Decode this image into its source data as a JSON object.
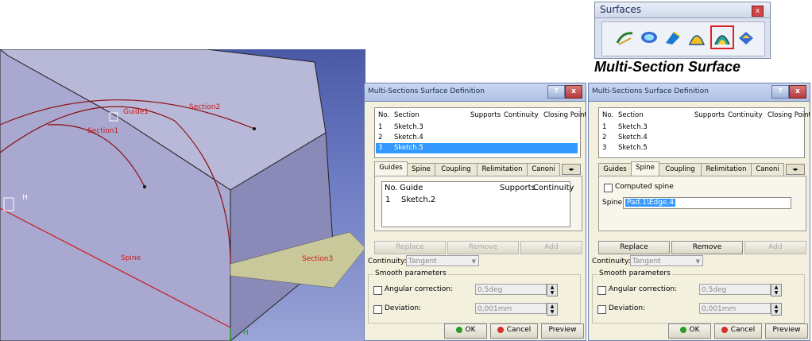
{
  "viewport": {
    "labels": {
      "guide1": "Guide1",
      "section2": "Section2",
      "section1": "Section1",
      "section3": "Section3",
      "spine": "Spine",
      "h_left": "H",
      "h_bottom": "H"
    }
  },
  "toolbar": {
    "title": "Surfaces",
    "close": "x",
    "icons": [
      "sweep-icon",
      "fill-icon",
      "extrude-icon",
      "loft-icon",
      "multi-section-surface-icon",
      "blend-icon"
    ],
    "highlight_color": "#e02020"
  },
  "caption": "Multi-Section Surface",
  "dialog1": {
    "title": "Multi-Sections Surface Definition",
    "help": "?",
    "close": "x",
    "columns": [
      "No.",
      "Section",
      "Supports",
      "Continuity",
      "Closing Point"
    ],
    "rows": [
      {
        "no": "1",
        "section": "Sketch.3"
      },
      {
        "no": "2",
        "section": "Sketch.4"
      },
      {
        "no": "3",
        "section": "Sketch.5"
      }
    ],
    "selected_row": 3,
    "tabs": [
      "Guides",
      "Spine",
      "Coupling",
      "Relimitation",
      "Canoni"
    ],
    "tab_scroll": "◂▸",
    "active_tab": "Guides",
    "guide_columns": [
      "No.",
      "Guide",
      "Supports",
      "Continuity"
    ],
    "guide_rows": [
      {
        "no": "1",
        "guide": "Sketch.2"
      }
    ],
    "replace": "Replace",
    "remove": "Remove",
    "add": "Add",
    "continuity_label": "Continuity:",
    "continuity_value": "Tangent",
    "smooth_title": "Smooth parameters",
    "angular_label": "Angular correction:",
    "angular_value": "0,5deg",
    "deviation_label": "Deviation:",
    "deviation_value": "0,001mm",
    "ok": "OK",
    "cancel": "Cancel",
    "preview": "Preview"
  },
  "dialog2": {
    "title": "Multi-Sections Surface Definition",
    "help": "?",
    "close": "x",
    "columns": [
      "No.",
      "Section",
      "Supports",
      "Continuity",
      "Closing Point"
    ],
    "rows": [
      {
        "no": "1",
        "section": "Sketch.3"
      },
      {
        "no": "2",
        "section": "Sketch.4"
      },
      {
        "no": "3",
        "section": "Sketch.5"
      }
    ],
    "tabs": [
      "Guides",
      "Spine",
      "Coupling",
      "Relimitation",
      "Canoni"
    ],
    "tab_scroll": "◂▸",
    "active_tab": "Spine",
    "computed_spine": "Computed spine",
    "spine_label": "Spine:",
    "spine_value": "Pad.1\\Edge.4",
    "replace": "Replace",
    "remove": "Remove",
    "add": "Add",
    "continuity_label": "Continuity:",
    "continuity_value": "Tangent",
    "smooth_title": "Smooth parameters",
    "angular_label": "Angular correction:",
    "angular_value": "0,5deg",
    "deviation_label": "Deviation:",
    "deviation_value": "0,001mm",
    "ok": "OK",
    "cancel": "Cancel",
    "preview": "Preview"
  }
}
